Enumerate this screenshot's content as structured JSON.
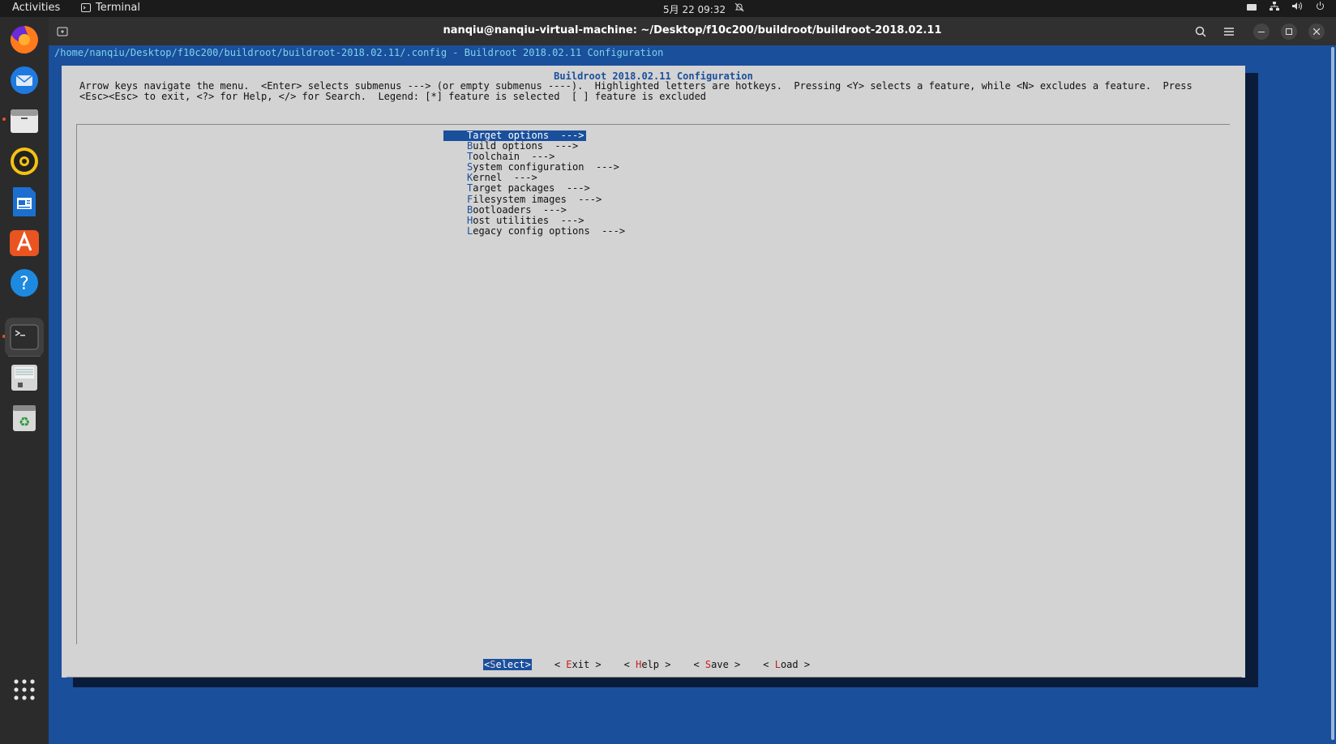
{
  "topbar": {
    "activities": "Activities",
    "app_name": "Terminal",
    "clock": "5月 22  09:32"
  },
  "dock": {
    "items": [
      "firefox-icon",
      "thunderbird-icon",
      "files-icon",
      "rhythmbox-icon",
      "writer-icon",
      "app-center-icon",
      "help-icon",
      "terminal-icon",
      "disk-icon",
      "trash-icon",
      "show-apps-icon"
    ]
  },
  "window": {
    "title": "nanqiu@nanqiu-virtual-machine: ~/Desktop/f10c200/buildroot/buildroot-2018.02.11"
  },
  "terminal": {
    "path_line": "/home/nanqiu/Desktop/f10c200/buildroot/buildroot-2018.02.11/.config - Buildroot 2018.02.11 Configuration",
    "dialog_title": "Buildroot 2018.02.11 Configuration",
    "help_line1": "Arrow keys navigate the menu.  <Enter> selects submenus ---> (or empty submenus ----).  Highlighted letters are hotkeys.  Pressing <Y> selects a feature, while <N> excludes a feature.  Press",
    "help_line2": "<Esc><Esc> to exit, <?> for Help, </> for Search.  Legend: [*] feature is selected  [ ] feature is excluded",
    "menu": [
      {
        "hotkey": "T",
        "rest": "arget options  --->"
      },
      {
        "hotkey": "B",
        "rest": "uild options  --->"
      },
      {
        "hotkey": "T",
        "rest": "oolchain  --->"
      },
      {
        "hotkey": "S",
        "rest": "ystem configuration  --->"
      },
      {
        "hotkey": "K",
        "rest": "ernel  --->"
      },
      {
        "hotkey": "T",
        "rest": "arget packages  --->"
      },
      {
        "hotkey": "F",
        "rest": "ilesystem images  --->"
      },
      {
        "hotkey": "B",
        "rest": "ootloaders  --->"
      },
      {
        "hotkey": "H",
        "rest": "ost utilities  --->"
      },
      {
        "hotkey": "L",
        "rest": "egacy config options  --->"
      }
    ],
    "selected_index": 0,
    "buttons": [
      {
        "pre": "<",
        "hotkey": "S",
        "rest": "elect>"
      },
      {
        "pre": "< ",
        "hotkey": "E",
        "rest": "xit >"
      },
      {
        "pre": "< ",
        "hotkey": "H",
        "rest": "elp >"
      },
      {
        "pre": "< ",
        "hotkey": "S",
        "rest": "ave >"
      },
      {
        "pre": "< ",
        "hotkey": "L",
        "rest": "oad >"
      }
    ]
  }
}
